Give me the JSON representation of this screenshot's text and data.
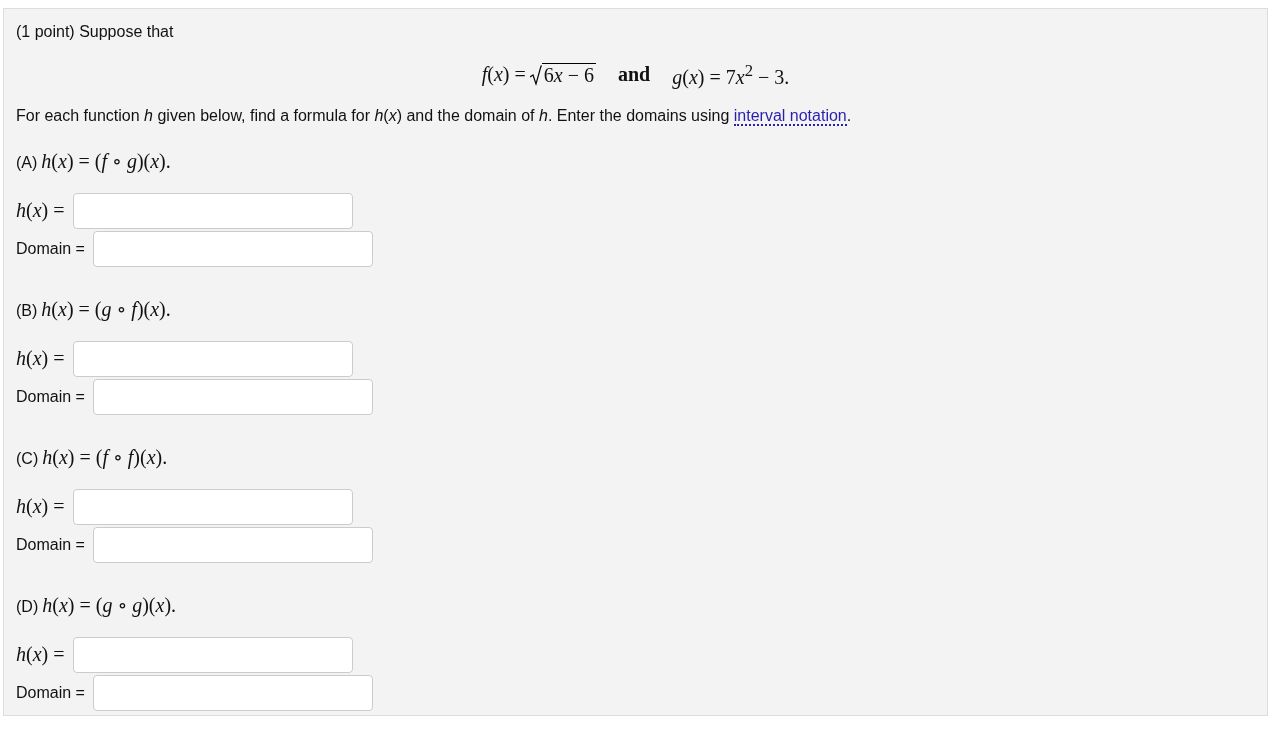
{
  "problem": {
    "intro": "(1 point) Suppose that",
    "formula": {
      "f_lhs": "*f*(*x*) =",
      "f_radicand": [
        "6",
        "*x* − 6"
      ],
      "joiner": "and",
      "g": [
        "*g*(*x*) = 7",
        "*x*$^{2}$ − 3."
      ]
    },
    "instruction": {
      "before": "For each function *h* given below, find a formula for *h*(*x*) and the domain of *h*. Enter the domains using ",
      "link": "interval notation",
      "after": "."
    },
    "parts": [
      {
        "label": "(A)",
        "expr": "*h*(*x*) = (*f* ∘ *g*)(*x*).",
        "answer_label": "*h*(*x*) =",
        "domain_label": "Domain ="
      },
      {
        "label": "(B)",
        "expr": "*h*(*x*) = (*g* ∘ *f*)(*x*).",
        "answer_label": "*h*(*x*) =",
        "domain_label": "Domain ="
      },
      {
        "label": "(C)",
        "expr": "*h*(*x*) = (*f* ∘ *f*)(*x*).",
        "answer_label": "*h*(*x*) =",
        "domain_label": "Domain ="
      },
      {
        "label": "(D)",
        "expr": "*h*(*x*) = (*g* ∘ *g*)(*x*).",
        "answer_label": "*h*(*x*) =",
        "domain_label": "Domain ="
      }
    ]
  }
}
